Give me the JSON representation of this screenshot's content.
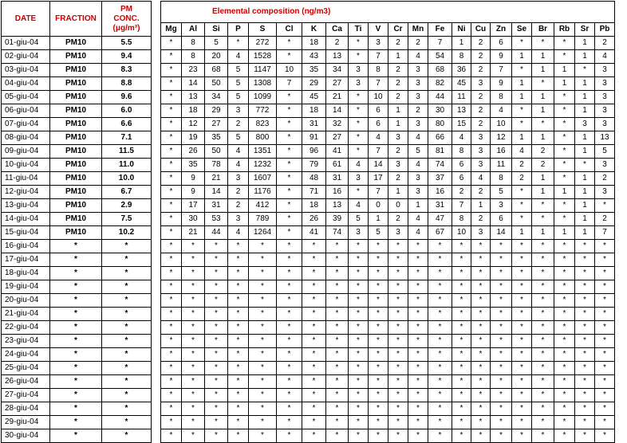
{
  "headers": {
    "date": "DATE",
    "fraction": "FRACTION",
    "pm_line1": "PM",
    "pm_line2": "CONC.",
    "pm_line3": "(μg/m³)",
    "elemental_title": "Elemental composition (ng/m3)"
  },
  "elements": [
    "Mg",
    "Al",
    "Si",
    "P",
    "S",
    "Cl",
    "K",
    "Ca",
    "Ti",
    "V",
    "Cr",
    "Mn",
    "Fe",
    "Ni",
    "Cu",
    "Zn",
    "Se",
    "Br",
    "Rb",
    "Sr",
    "Pb"
  ],
  "rows": [
    {
      "date": "01-giu-04",
      "fraction": "PM10",
      "conc": "5.5",
      "values": [
        "*",
        "8",
        "5",
        "*",
        "272",
        "*",
        "18",
        "2",
        "*",
        "3",
        "2",
        "2",
        "7",
        "1",
        "2",
        "6",
        "*",
        "*",
        "*",
        "1",
        "2"
      ]
    },
    {
      "date": "02-giu-04",
      "fraction": "PM10",
      "conc": "9.4",
      "values": [
        "*",
        "8",
        "20",
        "4",
        "1528",
        "*",
        "43",
        "13",
        "*",
        "7",
        "1",
        "4",
        "54",
        "8",
        "2",
        "9",
        "1",
        "1",
        "*",
        "1",
        "4"
      ]
    },
    {
      "date": "03-giu-04",
      "fraction": "PM10",
      "conc": "8.3",
      "values": [
        "*",
        "23",
        "68",
        "5",
        "1147",
        "10",
        "35",
        "34",
        "3",
        "8",
        "2",
        "3",
        "68",
        "36",
        "2",
        "7",
        "*",
        "1",
        "1",
        "*",
        "3"
      ]
    },
    {
      "date": "04-giu-04",
      "fraction": "PM10",
      "conc": "8.8",
      "values": [
        "*",
        "14",
        "50",
        "5",
        "1308",
        "7",
        "29",
        "27",
        "3",
        "7",
        "2",
        "3",
        "82",
        "45",
        "3",
        "9",
        "1",
        "*",
        "1",
        "1",
        "3"
      ]
    },
    {
      "date": "05-giu-04",
      "fraction": "PM10",
      "conc": "9.6",
      "values": [
        "*",
        "13",
        "34",
        "5",
        "1099",
        "*",
        "45",
        "21",
        "*",
        "10",
        "2",
        "3",
        "44",
        "11",
        "2",
        "8",
        "1",
        "1",
        "*",
        "1",
        "3"
      ]
    },
    {
      "date": "06-giu-04",
      "fraction": "PM10",
      "conc": "6.0",
      "values": [
        "*",
        "18",
        "29",
        "3",
        "772",
        "*",
        "18",
        "14",
        "*",
        "6",
        "1",
        "2",
        "30",
        "13",
        "2",
        "4",
        "*",
        "1",
        "*",
        "1",
        "3"
      ]
    },
    {
      "date": "07-giu-04",
      "fraction": "PM10",
      "conc": "6.6",
      "values": [
        "*",
        "12",
        "27",
        "2",
        "823",
        "*",
        "31",
        "32",
        "*",
        "6",
        "1",
        "3",
        "80",
        "15",
        "2",
        "10",
        "*",
        "*",
        "*",
        "3",
        "3"
      ]
    },
    {
      "date": "08-giu-04",
      "fraction": "PM10",
      "conc": "7.1",
      "values": [
        "*",
        "19",
        "35",
        "5",
        "800",
        "*",
        "91",
        "27",
        "*",
        "4",
        "3",
        "4",
        "66",
        "4",
        "3",
        "12",
        "1",
        "1",
        "*",
        "1",
        "13"
      ]
    },
    {
      "date": "09-giu-04",
      "fraction": "PM10",
      "conc": "11.5",
      "values": [
        "*",
        "26",
        "50",
        "4",
        "1351",
        "*",
        "96",
        "41",
        "*",
        "7",
        "2",
        "5",
        "81",
        "8",
        "3",
        "16",
        "4",
        "2",
        "*",
        "1",
        "5"
      ]
    },
    {
      "date": "10-giu-04",
      "fraction": "PM10",
      "conc": "11.0",
      "values": [
        "*",
        "35",
        "78",
        "4",
        "1232",
        "*",
        "79",
        "61",
        "4",
        "14",
        "3",
        "4",
        "74",
        "6",
        "3",
        "11",
        "2",
        "2",
        "*",
        "*",
        "3"
      ]
    },
    {
      "date": "11-giu-04",
      "fraction": "PM10",
      "conc": "10.0",
      "values": [
        "*",
        "9",
        "21",
        "3",
        "1607",
        "*",
        "48",
        "31",
        "3",
        "17",
        "2",
        "3",
        "37",
        "6",
        "4",
        "8",
        "2",
        "1",
        "*",
        "1",
        "2"
      ]
    },
    {
      "date": "12-giu-04",
      "fraction": "PM10",
      "conc": "6.7",
      "values": [
        "*",
        "9",
        "14",
        "2",
        "1176",
        "*",
        "71",
        "16",
        "*",
        "7",
        "1",
        "3",
        "16",
        "2",
        "2",
        "5",
        "*",
        "1",
        "1",
        "1",
        "3"
      ]
    },
    {
      "date": "13-giu-04",
      "fraction": "PM10",
      "conc": "2.9",
      "values": [
        "*",
        "17",
        "31",
        "2",
        "412",
        "*",
        "18",
        "13",
        "4",
        "0",
        "0",
        "1",
        "31",
        "7",
        "1",
        "3",
        "*",
        "*",
        "*",
        "1",
        "*"
      ]
    },
    {
      "date": "14-giu-04",
      "fraction": "PM10",
      "conc": "7.5",
      "values": [
        "*",
        "30",
        "53",
        "3",
        "789",
        "*",
        "26",
        "39",
        "5",
        "1",
        "2",
        "4",
        "47",
        "8",
        "2",
        "6",
        "*",
        "*",
        "*",
        "1",
        "2"
      ]
    },
    {
      "date": "15-giu-04",
      "fraction": "PM10",
      "conc": "10.2",
      "values": [
        "*",
        "21",
        "44",
        "4",
        "1264",
        "*",
        "41",
        "74",
        "3",
        "5",
        "3",
        "4",
        "67",
        "10",
        "3",
        "14",
        "1",
        "1",
        "1",
        "1",
        "7"
      ]
    },
    {
      "date": "16-giu-04",
      "fraction": "*",
      "conc": "*",
      "values": [
        "*",
        "*",
        "*",
        "*",
        "*",
        "*",
        "*",
        "*",
        "*",
        "*",
        "*",
        "*",
        "*",
        "*",
        "*",
        "*",
        "*",
        "*",
        "*",
        "*",
        "*"
      ]
    },
    {
      "date": "17-giu-04",
      "fraction": "*",
      "conc": "*",
      "values": [
        "*",
        "*",
        "*",
        "*",
        "*",
        "*",
        "*",
        "*",
        "*",
        "*",
        "*",
        "*",
        "*",
        "*",
        "*",
        "*",
        "*",
        "*",
        "*",
        "*",
        "*"
      ]
    },
    {
      "date": "18-giu-04",
      "fraction": "*",
      "conc": "*",
      "values": [
        "*",
        "*",
        "*",
        "*",
        "*",
        "*",
        "*",
        "*",
        "*",
        "*",
        "*",
        "*",
        "*",
        "*",
        "*",
        "*",
        "*",
        "*",
        "*",
        "*",
        "*"
      ]
    },
    {
      "date": "19-giu-04",
      "fraction": "*",
      "conc": "*",
      "values": [
        "*",
        "*",
        "*",
        "*",
        "*",
        "*",
        "*",
        "*",
        "*",
        "*",
        "*",
        "*",
        "*",
        "*",
        "*",
        "*",
        "*",
        "*",
        "*",
        "*",
        "*"
      ]
    },
    {
      "date": "20-giu-04",
      "fraction": "*",
      "conc": "*",
      "values": [
        "*",
        "*",
        "*",
        "*",
        "*",
        "*",
        "*",
        "*",
        "*",
        "*",
        "*",
        "*",
        "*",
        "*",
        "*",
        "*",
        "*",
        "*",
        "*",
        "*",
        "*"
      ]
    },
    {
      "date": "21-giu-04",
      "fraction": "*",
      "conc": "*",
      "values": [
        "*",
        "*",
        "*",
        "*",
        "*",
        "*",
        "*",
        "*",
        "*",
        "*",
        "*",
        "*",
        "*",
        "*",
        "*",
        "*",
        "*",
        "*",
        "*",
        "*",
        "*"
      ]
    },
    {
      "date": "22-giu-04",
      "fraction": "*",
      "conc": "*",
      "values": [
        "*",
        "*",
        "*",
        "*",
        "*",
        "*",
        "*",
        "*",
        "*",
        "*",
        "*",
        "*",
        "*",
        "*",
        "*",
        "*",
        "*",
        "*",
        "*",
        "*",
        "*"
      ]
    },
    {
      "date": "23-giu-04",
      "fraction": "*",
      "conc": "*",
      "values": [
        "*",
        "*",
        "*",
        "*",
        "*",
        "*",
        "*",
        "*",
        "*",
        "*",
        "*",
        "*",
        "*",
        "*",
        "*",
        "*",
        "*",
        "*",
        "*",
        "*",
        "*"
      ]
    },
    {
      "date": "24-giu-04",
      "fraction": "*",
      "conc": "*",
      "values": [
        "*",
        "*",
        "*",
        "*",
        "*",
        "*",
        "*",
        "*",
        "*",
        "*",
        "*",
        "*",
        "*",
        "*",
        "*",
        "*",
        "*",
        "*",
        "*",
        "*",
        "*"
      ]
    },
    {
      "date": "25-giu-04",
      "fraction": "*",
      "conc": "*",
      "values": [
        "*",
        "*",
        "*",
        "*",
        "*",
        "*",
        "*",
        "*",
        "*",
        "*",
        "*",
        "*",
        "*",
        "*",
        "*",
        "*",
        "*",
        "*",
        "*",
        "*",
        "*"
      ]
    },
    {
      "date": "26-giu-04",
      "fraction": "*",
      "conc": "*",
      "values": [
        "*",
        "*",
        "*",
        "*",
        "*",
        "*",
        "*",
        "*",
        "*",
        "*",
        "*",
        "*",
        "*",
        "*",
        "*",
        "*",
        "*",
        "*",
        "*",
        "*",
        "*"
      ]
    },
    {
      "date": "27-giu-04",
      "fraction": "*",
      "conc": "*",
      "values": [
        "*",
        "*",
        "*",
        "*",
        "*",
        "*",
        "*",
        "*",
        "*",
        "*",
        "*",
        "*",
        "*",
        "*",
        "*",
        "*",
        "*",
        "*",
        "*",
        "*",
        "*"
      ]
    },
    {
      "date": "28-giu-04",
      "fraction": "*",
      "conc": "*",
      "values": [
        "*",
        "*",
        "*",
        "*",
        "*",
        "*",
        "*",
        "*",
        "*",
        "*",
        "*",
        "*",
        "*",
        "*",
        "*",
        "*",
        "*",
        "*",
        "*",
        "*",
        "*"
      ]
    },
    {
      "date": "29-giu-04",
      "fraction": "*",
      "conc": "*",
      "values": [
        "*",
        "*",
        "*",
        "*",
        "*",
        "*",
        "*",
        "*",
        "*",
        "*",
        "*",
        "*",
        "*",
        "*",
        "*",
        "*",
        "*",
        "*",
        "*",
        "*",
        "*"
      ]
    },
    {
      "date": "30-giu-04",
      "fraction": "*",
      "conc": "*",
      "values": [
        "*",
        "*",
        "*",
        "*",
        "*",
        "*",
        "*",
        "*",
        "*",
        "*",
        "*",
        "*",
        "*",
        "*",
        "*",
        "*",
        "*",
        "*",
        "*",
        "*",
        "*"
      ]
    }
  ],
  "colors": {
    "header_red": "#cc0000"
  }
}
